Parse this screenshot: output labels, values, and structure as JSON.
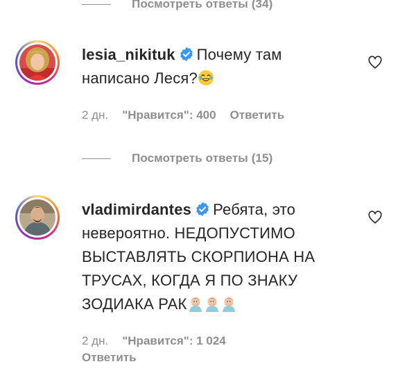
{
  "replies_top": {
    "label": "Посмотреть ответы (34)"
  },
  "comment1": {
    "username": "lesia_nikituk",
    "text": "Почему там написано Леся?",
    "emoji": "joy-emoji",
    "time": "2 дн.",
    "likes": "\"Нравится\": 400",
    "reply": "Ответить"
  },
  "replies_mid": {
    "label": "Посмотреть ответы (15)"
  },
  "comment2": {
    "username": "vladimirdantes",
    "text": "Ребята, это невероятно. НЕДОПУСТИМО ВЫСТАВЛЯТЬ СКОРПИОНА НА ТРУСАХ, КОГДА Я ПО ЗНАКУ ЗОДИАКА РАК",
    "emoji": "facepalm-emoji",
    "time": "2 дн.",
    "likes": "\"Нравится\": 1 024",
    "reply": "Ответить"
  },
  "colors": {
    "verified": "#3897f0",
    "meta": "#8e8e8e",
    "text": "#262626"
  }
}
